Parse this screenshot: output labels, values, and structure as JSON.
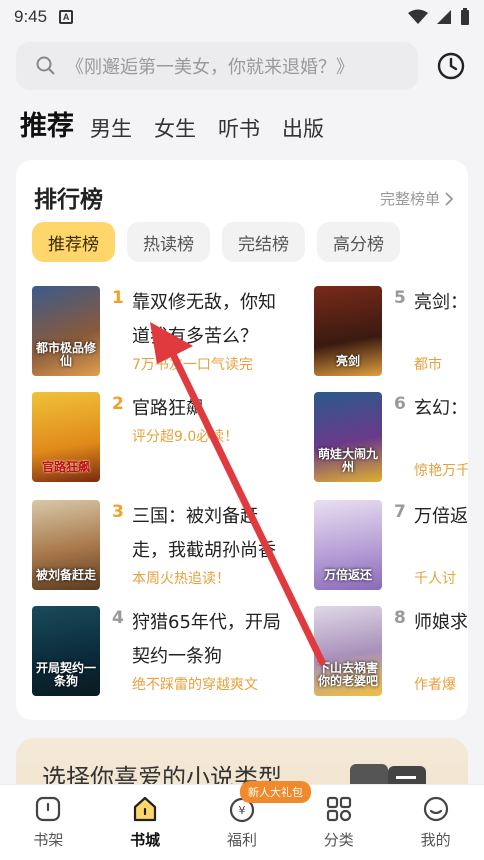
{
  "status_bar": {
    "time": "9:45",
    "sim_label": "A"
  },
  "search": {
    "placeholder": "《刚邂逅第一美女，你就来退婚？》"
  },
  "tabs": [
    {
      "label": "推荐",
      "active": true
    },
    {
      "label": "男生"
    },
    {
      "label": "女生"
    },
    {
      "label": "听书"
    },
    {
      "label": "出版"
    }
  ],
  "ranking": {
    "title": "排行榜",
    "more": "完整榜单",
    "chips": [
      "推荐榜",
      "热读榜",
      "完结榜",
      "高分榜"
    ],
    "books_left": [
      {
        "rank": "1",
        "title": "靠双修无敌，你知道我有多苦么？",
        "sub": "7万书友一口气读完",
        "cover_text": "都市极品修仙"
      },
      {
        "rank": "2",
        "title": "官路狂飙",
        "sub": "评分超9.0必读！",
        "cover_text": "官路狂飙"
      },
      {
        "rank": "3",
        "title": "三国：被刘备赶走，我截胡孙尚香",
        "sub": "本周火热追读！",
        "cover_text": "被刘备赶走"
      },
      {
        "rank": "4",
        "title": "狩猎65年代，开局契约一条狗",
        "sub": "绝不踩雷的穿越爽文",
        "cover_text": "开局契约一条狗"
      }
    ],
    "books_right": [
      {
        "rank": "5",
        "title": "亮剑：班，全",
        "sub": "都市",
        "cover_text": "亮剑"
      },
      {
        "rank": "6",
        "title": "玄幻：萌娃大",
        "sub": "惊艳万千",
        "cover_text": "萌娃大闹九州"
      },
      {
        "rank": "7",
        "title": "万倍返姐采补",
        "sub": "千人讨",
        "cover_text": "万倍返还"
      },
      {
        "rank": "8",
        "title": "师娘求去祸害",
        "sub": "作者爆",
        "cover_text": "下山去祸害你的老婆吧"
      }
    ]
  },
  "promo": {
    "text": "选择你喜爱的小说类型"
  },
  "bottom_nav": [
    {
      "label": "书架",
      "icon": "bookshelf-icon"
    },
    {
      "label": "书城",
      "icon": "bookstore-icon",
      "active": true
    },
    {
      "label": "福利",
      "icon": "bonus-icon",
      "badge": "新人大礼包"
    },
    {
      "label": "分类",
      "icon": "category-icon"
    },
    {
      "label": "我的",
      "icon": "profile-icon"
    }
  ],
  "colors": {
    "accent": "#f0a226",
    "chip_active": "#ffd66b",
    "annotation_arrow": "#e0393e"
  }
}
